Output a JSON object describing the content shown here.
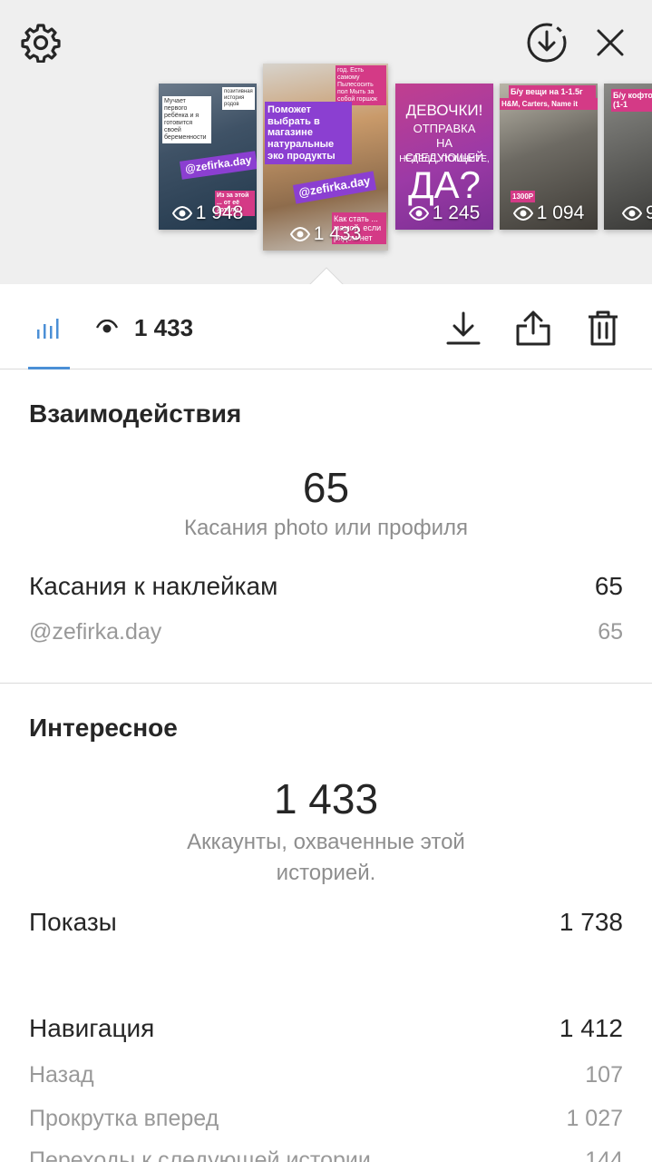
{
  "tray": {
    "thumbnails": [
      {
        "views": "1 948",
        "caption": "@zefirka.day",
        "top_text": "Мучает первого ребёнка и я готовится своей беременности",
        "corner_text": "позитивная история родов",
        "bottom_text": "Из за этой ... от её хотели"
      },
      {
        "views": "1 433",
        "caption": "@zefirka.day",
        "headline": "Поможет выбрать в магазине натуральные эко продукты",
        "top_text": "год. Есть самому Пылесосить пол Мыть за собой горшок",
        "bottom_text": "Как стать ... мамой, если рядом нет"
      },
      {
        "views": "1 245",
        "line1": "ДЕВОЧКИ!",
        "line2": "ОТПРАВКА НА СЛЕДУЮЩЕЙ",
        "line3": "НЕДЕЛЕ, ПОМНИТЕ,",
        "line4": "ДА?"
      },
      {
        "views": "1 094",
        "top_text": "Б/у вещи на 1-1.5г",
        "brands": "H&M, Carters, Name it",
        "price": "1300Р"
      },
      {
        "views": "9",
        "top_text": "Б/у кофто (1-1"
      }
    ]
  },
  "statbar": {
    "views": "1 433"
  },
  "interactions": {
    "title": "Взаимодействия",
    "total": "65",
    "total_label": "Касания photo или профиля",
    "rows": [
      {
        "label": "Касания к наклейкам",
        "value": "65"
      }
    ],
    "subrows": [
      {
        "label": "@zefirka.day",
        "value": "65"
      }
    ]
  },
  "discovery": {
    "title": "Интересное",
    "total": "1 433",
    "total_label": "Аккаунты, охваченные этой историей.",
    "impressions": {
      "label": "Показы",
      "value": "1 738"
    },
    "navigation": {
      "label": "Навигация",
      "value": "1 412"
    },
    "nav_rows": [
      {
        "label": "Назад",
        "value": "107"
      },
      {
        "label": "Прокрутка вперед",
        "value": "1 027"
      },
      {
        "label": "Переходы к следующей истории",
        "value": "144"
      }
    ]
  },
  "colors": {
    "accent": "#4b8fd6",
    "text": "#262626",
    "muted": "#8e8e8e",
    "tray_bg": "#efefef"
  }
}
